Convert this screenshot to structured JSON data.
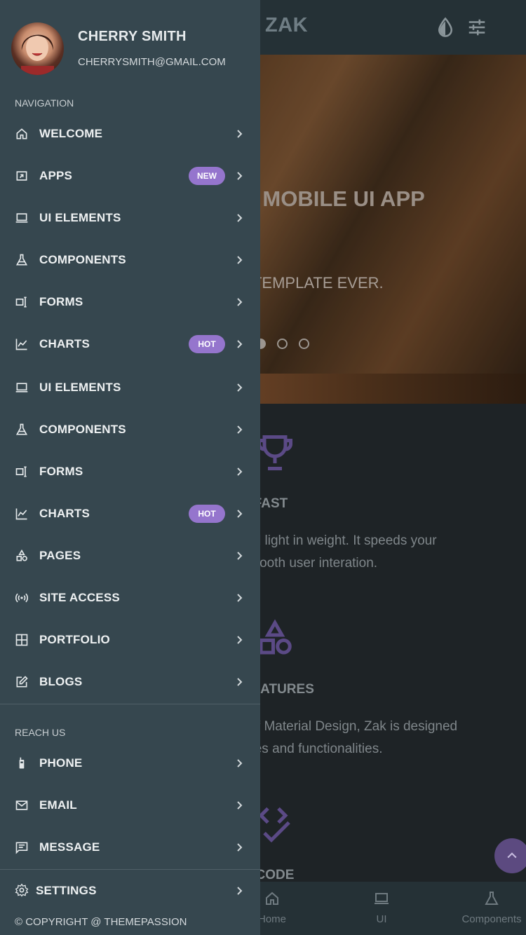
{
  "app": {
    "brand": "ZAK"
  },
  "colors": {
    "drawer_bg": "#36474f",
    "accent": "#9575cd",
    "topbar_bg": "#253136",
    "page_bg": "#1e2326"
  },
  "topbar_icons": [
    "opacity-icon",
    "tune-icon"
  ],
  "hero": {
    "title": "M MOBILE UI APP",
    "subtitle": "P TEMPLATE EVER.",
    "slides": 3,
    "active_slide": 1
  },
  "features": [
    {
      "icon": "trophy-icon",
      "title": "ER FAST",
      "lines": [
        "t and light in weight. It speeds your",
        "s smooth user interation."
      ]
    },
    {
      "icon": "shapes-icon",
      "title": "F FEATURES",
      "lines": [
        "es of Material Design, Zak is designed",
        "atures and functionalities."
      ]
    },
    {
      "icon": "code-check-icon",
      "title": "ITY CODE",
      "lines": []
    }
  ],
  "bottom_nav": [
    {
      "icon": "home-icon",
      "label": "Home"
    },
    {
      "icon": "laptop-icon",
      "label": "UI"
    },
    {
      "icon": "flask-icon",
      "label": "Components"
    }
  ],
  "drawer": {
    "user": {
      "name": "CHERRY SMITH",
      "email": "CHERRYSMITH@GMAIL.COM"
    },
    "nav_label": "NAVIGATION",
    "nav_items": [
      {
        "icon": "home-icon",
        "label": "WELCOME",
        "badge": ""
      },
      {
        "icon": "apps-icon",
        "label": "APPS",
        "badge": "NEW"
      },
      {
        "icon": "laptop-icon",
        "label": "UI ELEMENTS",
        "badge": ""
      },
      {
        "icon": "flask-icon",
        "label": "COMPONENTS",
        "badge": ""
      },
      {
        "icon": "form-icon",
        "label": "FORMS",
        "badge": ""
      },
      {
        "icon": "chart-icon",
        "label": "CHARTS",
        "badge": "HOT"
      },
      {
        "icon": "laptop-icon",
        "label": "UI ELEMENTS",
        "badge": ""
      },
      {
        "icon": "flask-icon",
        "label": "COMPONENTS",
        "badge": ""
      },
      {
        "icon": "form-icon",
        "label": "FORMS",
        "badge": ""
      },
      {
        "icon": "chart-icon",
        "label": "CHARTS",
        "badge": "HOT"
      },
      {
        "icon": "shapes-icon",
        "label": "PAGES",
        "badge": ""
      },
      {
        "icon": "broadcast-icon",
        "label": "SITE ACCESS",
        "badge": ""
      },
      {
        "icon": "grid-icon",
        "label": "PORTFOLIO",
        "badge": ""
      },
      {
        "icon": "edit-icon",
        "label": "BLOGS",
        "badge": ""
      }
    ],
    "reach_label": "REACH US",
    "reach_items": [
      {
        "icon": "phone-icon",
        "label": "PHONE"
      },
      {
        "icon": "mail-icon",
        "label": "EMAIL"
      },
      {
        "icon": "message-icon",
        "label": "MESSAGE"
      }
    ],
    "settings_label": "SETTINGS",
    "copyright": "© COPYRIGHT @ THEMEPASSION"
  }
}
